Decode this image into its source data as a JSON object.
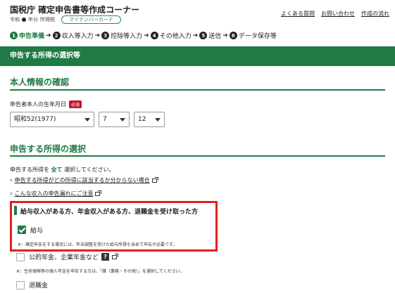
{
  "header": {
    "title": "国税庁 確定申告書等作成コーナー",
    "era": "令和",
    "year_label": "年分",
    "tax_type": "所得税",
    "mynumber_label": "マイナンバーカード",
    "links": [
      "よくある質問",
      "お問い合わせ",
      "作成の流れ"
    ]
  },
  "steps": [
    {
      "num": "1",
      "label": "申告準備",
      "active": true
    },
    {
      "num": "2",
      "label": "収入等入力"
    },
    {
      "num": "3",
      "label": "控除等入力"
    },
    {
      "num": "4",
      "label": "その他入力"
    },
    {
      "num": "5",
      "label": "送信"
    },
    {
      "num": "6",
      "label": "データ保存等"
    }
  ],
  "banner": "申告する所得の選択等",
  "personal": {
    "heading": "本人情報の確認",
    "birth_label": "申告者本人の生年月日",
    "required": "必須",
    "year": "昭和52(1977)",
    "month": "7",
    "day": "12"
  },
  "income": {
    "heading": "申告する所得の選択",
    "instruction_pre": "申告する所得を",
    "instruction_bold": "全て",
    "instruction_post": "選択してください。",
    "link1": "申告する所得がどの所得に該当するか分からない場合",
    "link2": "こんな収入の申告漏れにご注意",
    "group_title": "給与収入がある方、年金収入がある方、退職金を受け取った方",
    "salary_label": "給与",
    "salary_note": "※：確定申告をする場合には、年末調整を受けた給与所得も含めて申告が必要です。",
    "pension_label": "公的年金、企業年金など",
    "pension_note": "※：生命保険等の個人年金を申告する方は、「雑（業務・その他）」を選択してください。",
    "retirement_label": "退職金",
    "help_badge": "?"
  },
  "colors": {
    "accent": "#1f7a45",
    "highlight": "#e02020",
    "required": "#c8102e"
  }
}
